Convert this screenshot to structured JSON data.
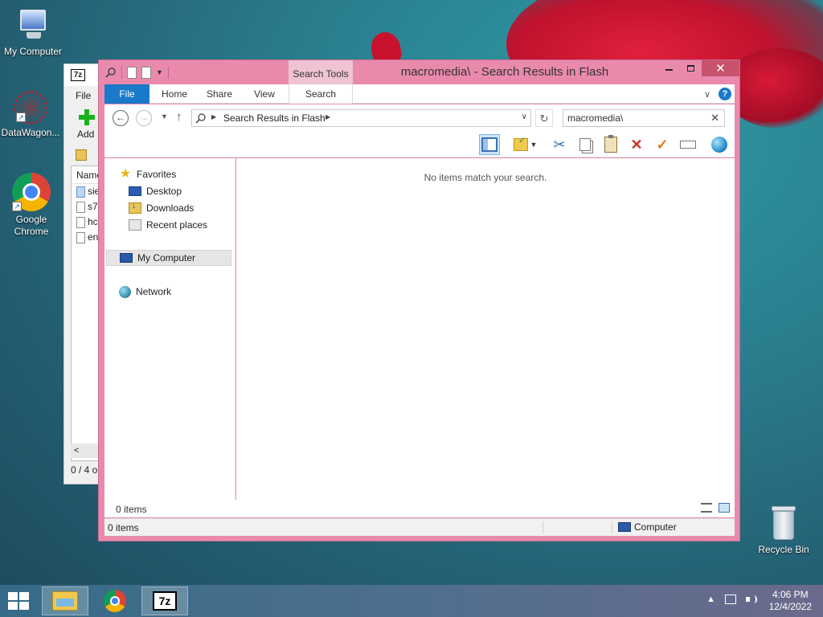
{
  "desktop": {
    "icons": [
      {
        "label": "My Computer"
      },
      {
        "label": "DataWagon..."
      },
      {
        "label": "Google Chrome"
      },
      {
        "label": "Recycle Bin"
      }
    ]
  },
  "zip_window": {
    "logo": "7z",
    "menu_file": "File",
    "add_label": "Add",
    "column_name": "Name",
    "files": [
      "sie",
      "s7",
      "hc",
      "en"
    ],
    "scroll_left": "<",
    "status": "0 / 4 o"
  },
  "explorer": {
    "title": "macromedia\\ - Search Results in Flash",
    "context_group": "Search Tools",
    "tabs": {
      "file": "File",
      "home": "Home",
      "share": "Share",
      "view": "View",
      "search": "Search"
    },
    "help_label": "?",
    "address": {
      "breadcrumb": "Search Results in Flash"
    },
    "search": {
      "value": "macromedia\\"
    },
    "nav_pane": {
      "favorites": "Favorites",
      "desktop": "Desktop",
      "downloads": "Downloads",
      "recent": "Recent places",
      "computer": "My Computer",
      "network": "Network"
    },
    "empty_message": "No items match your search.",
    "items_count": "0 items",
    "status": {
      "left": "0 items",
      "right": "Computer"
    }
  },
  "taskbar": {
    "apps": [
      "file-explorer",
      "google-chrome",
      "7-zip"
    ],
    "zip_label": "7z",
    "clock_time": "4:06 PM",
    "clock_date": "12/4/2022"
  },
  "colors": {
    "window_frame": "#e98aad",
    "ribbon_file_tab": "#1979ca",
    "close_button": "#c9526d"
  }
}
